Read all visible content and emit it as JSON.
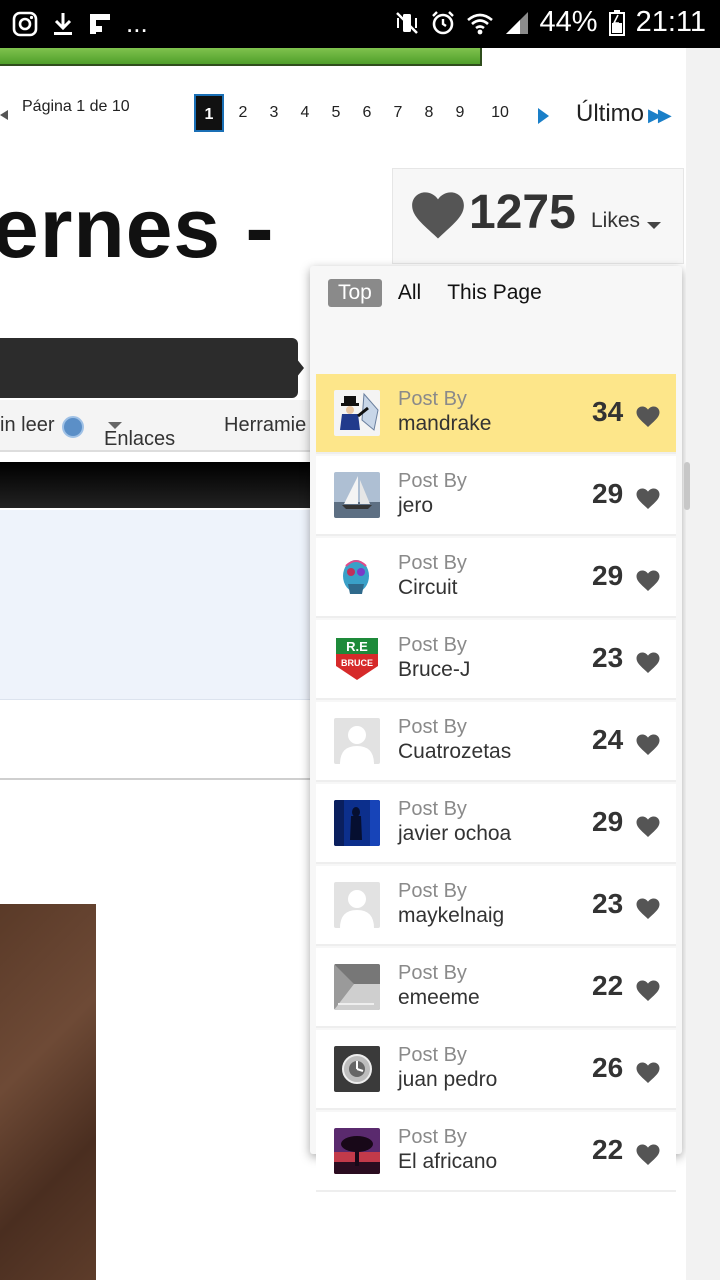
{
  "status_bar": {
    "ellipsis": "...",
    "battery": "44%",
    "time": "21:11"
  },
  "pagination": {
    "label": "Página 1 de 10",
    "pages": [
      "1",
      "2",
      "3",
      "4",
      "5",
      "6",
      "7",
      "8",
      "9",
      "10"
    ],
    "current": "1",
    "last_label": "Último"
  },
  "thread_title": "ernes -",
  "subnav": {
    "unread": "in leer",
    "links": "Enlaces",
    "tools": "Herramie"
  },
  "likes": {
    "count": "1275",
    "label": "Likes"
  },
  "dropdown": {
    "tabs": [
      "Top",
      "All",
      "This Page"
    ],
    "active_tab": "Top",
    "post_by_label": "Post By",
    "rows": [
      {
        "user": "mandrake",
        "count": "34",
        "avatar": "magician-avatar"
      },
      {
        "user": "jero",
        "count": "29",
        "avatar": "sailboat-avatar"
      },
      {
        "user": "Circuit",
        "count": "29",
        "avatar": "skull-art-avatar"
      },
      {
        "user": "Bruce-J",
        "count": "23",
        "avatar": "bruce-logo-avatar"
      },
      {
        "user": "Cuatrozetas",
        "count": "24",
        "avatar": "default-avatar"
      },
      {
        "user": "javier ochoa",
        "count": "29",
        "avatar": "blue-photo-avatar"
      },
      {
        "user": "maykelnaig",
        "count": "23",
        "avatar": "default-avatar"
      },
      {
        "user": "emeeme",
        "count": "22",
        "avatar": "gray-photo-avatar"
      },
      {
        "user": "juan pedro",
        "count": "26",
        "avatar": "watch-avatar"
      },
      {
        "user": "El africano",
        "count": "22",
        "avatar": "sunset-tree-avatar"
      }
    ]
  },
  "colors": {
    "highlight": "#fde68a",
    "link_blue": "#1a7fc8",
    "heart": "#555555"
  }
}
